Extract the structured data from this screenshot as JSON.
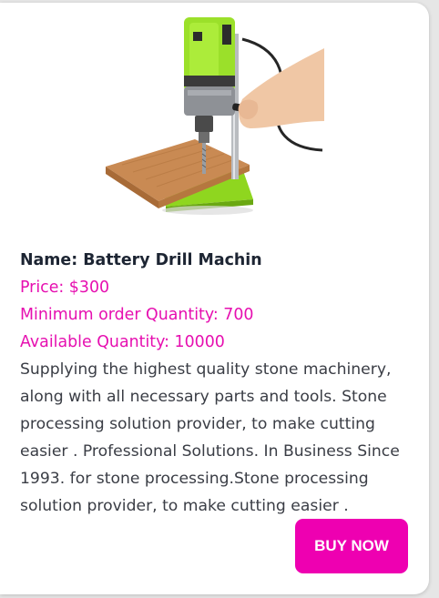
{
  "product": {
    "name": "Name: Battery Drill Machin",
    "price": "Price: $300",
    "min_order": "Minimum order Quantity: 700",
    "available": "Available Quantity: 10000",
    "description": "Supplying the highest quality stone machinery, along with all necessary parts and tools. Stone processing solution provider, to make cutting easier . Professional Solutions. In Business Since 1993. for stone processing.Stone processing solution provider, to make cutting easier .",
    "image_icon": "drill-press-icon"
  },
  "actions": {
    "buy_label": "BUY NOW"
  },
  "colors": {
    "accent": "#ee00b1",
    "detail_text": "#e60fb0",
    "name_text": "#1d2533",
    "body_text": "#3a3d45",
    "machine_green": "#9be02a",
    "wood": "#c98a53"
  }
}
